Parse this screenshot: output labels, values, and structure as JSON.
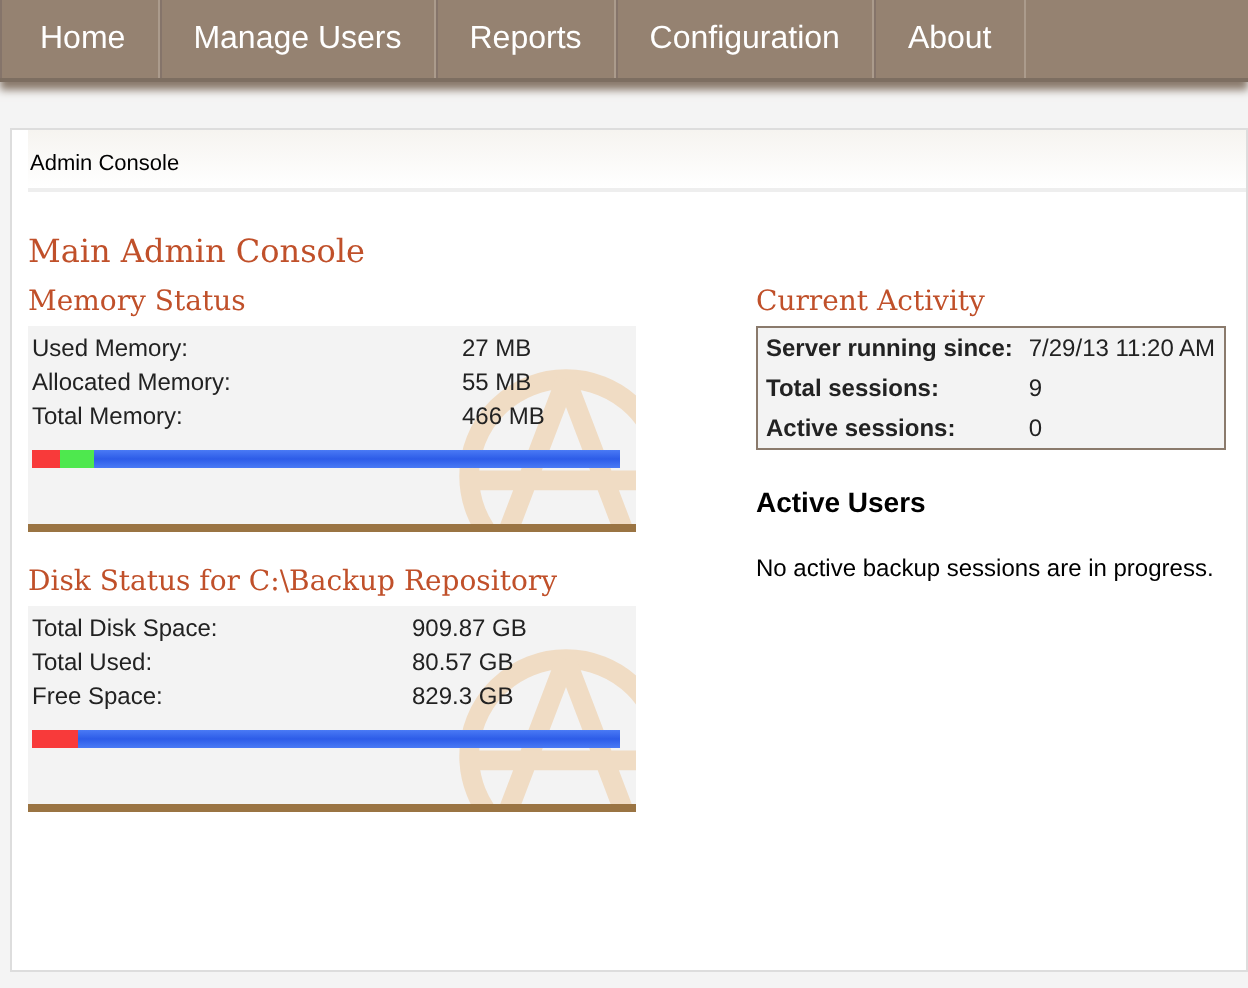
{
  "nav": [
    {
      "label": "Home"
    },
    {
      "label": "Manage Users"
    },
    {
      "label": "Reports"
    },
    {
      "label": "Configuration"
    },
    {
      "label": "About"
    }
  ],
  "breadcrumb": "Admin Console",
  "title": "Main Admin Console",
  "memory": {
    "heading": "Memory Status",
    "rows": [
      {
        "label": "Used Memory:",
        "value": "27 MB"
      },
      {
        "label": "Allocated Memory:",
        "value": "55 MB"
      },
      {
        "label": "Total Memory:",
        "value": "466 MB"
      }
    ],
    "segments": [
      {
        "color": "#f83a3a",
        "level": 0.048
      },
      {
        "color": "#4ee84e",
        "level": 0.058
      }
    ]
  },
  "disk": {
    "heading": "Disk Status for C:\\Backup Repository",
    "rows": [
      {
        "label": "Total Disk Space:",
        "value": "909.87 GB"
      },
      {
        "label": "Total Used:",
        "value": "80.57 GB"
      },
      {
        "label": "Free Space:",
        "value": "829.3 GB"
      }
    ],
    "segments": [
      {
        "color": "#f83a3a",
        "level": 0.078
      }
    ]
  },
  "activity": {
    "heading": "Current Activity",
    "rows": [
      {
        "label": "Server running since:",
        "value": "7/29/13 11:20 AM"
      },
      {
        "label": "Total sessions:",
        "value": "9"
      },
      {
        "label": "Active sessions:",
        "value": "0"
      }
    ]
  },
  "active_users": {
    "heading": "Active Users",
    "message": "No active backup sessions are in progress."
  }
}
